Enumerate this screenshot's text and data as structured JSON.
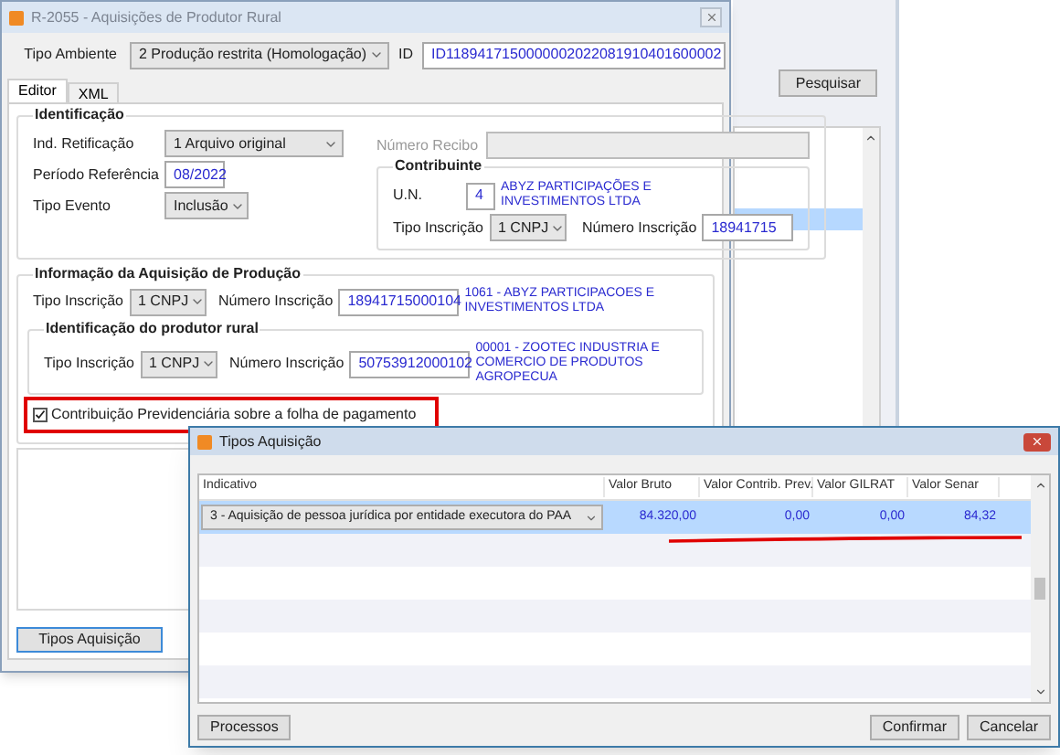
{
  "background_window": {
    "search_button": "Pesquisar"
  },
  "main_window": {
    "title": "R-2055 - Aquisições de Produtor Rural",
    "tipo_ambiente": {
      "label": "Tipo Ambiente",
      "value": "2 Produção restrita (Homologação)"
    },
    "id": {
      "label": "ID",
      "value": "ID1189417150000002022081910401600002"
    },
    "tabs": [
      {
        "label": "Editor",
        "selected": true
      },
      {
        "label": "XML",
        "selected": false
      }
    ],
    "identificacao": {
      "title": "Identificação",
      "ind_retificacao": {
        "label": "Ind. Retificação",
        "value": "1 Arquivo original"
      },
      "periodo_referencia": {
        "label": "Período Referência",
        "value": "08/2022"
      },
      "tipo_evento": {
        "label": "Tipo Evento",
        "value": "Inclusão"
      },
      "numero_recibo": {
        "label": "Número Recibo",
        "disabled": true
      },
      "contribuinte": {
        "title": "Contribuinte",
        "un": {
          "label": "U.N.",
          "value": "4",
          "name": "ABYZ PARTICIPAÇÕES E INVESTIMENTOS LTDA"
        },
        "tipo_inscricao": {
          "label": "Tipo Inscrição",
          "value": "1 CNPJ"
        },
        "numero_inscricao": {
          "label": "Número Inscrição",
          "value": "18941715"
        }
      }
    },
    "aquisicao": {
      "title": "Informação da Aquisição de Produção",
      "tipo_inscricao": {
        "label": "Tipo Inscrição",
        "value": "1 CNPJ"
      },
      "numero_inscricao": {
        "label": "Número Inscrição",
        "value": "18941715000104"
      },
      "name": "1061 - ABYZ PARTICIPACOES E INVESTIMENTOS LTDA",
      "produtor": {
        "title": "Identificação do produtor rural",
        "tipo_inscricao": {
          "label": "Tipo Inscrição",
          "value": "1 CNPJ"
        },
        "numero_inscricao": {
          "label": "Número Inscrição",
          "value": "50753912000102"
        },
        "name": "00001 - ZOOTEC INDUSTRIA E COMERCIO DE PRODUTOS AGROPECUA"
      },
      "contribuicao": {
        "label": "Contribuição Previdenciária sobre a folha de pagamento",
        "checked": true
      }
    },
    "tipos_button": "Tipos Aquisição"
  },
  "dialog": {
    "title": "Tipos Aquisição",
    "columns": [
      "Indicativo",
      "Valor Bruto",
      "Valor Contrib. Prev.",
      "Valor GILRAT",
      "Valor Senar"
    ],
    "rows": [
      {
        "indicativo": "3 - Aquisição de pessoa jurídica por entidade executora do PAA",
        "valor_bruto": "84.320,00",
        "valor_contrib_prev": "0,00",
        "valor_gilrat": "0,00",
        "valor_senar": "84,32",
        "selected": true
      }
    ],
    "buttons": [
      {
        "label": "Processos"
      },
      {
        "label": "Confirmar"
      },
      {
        "label": "Cancelar"
      }
    ]
  }
}
